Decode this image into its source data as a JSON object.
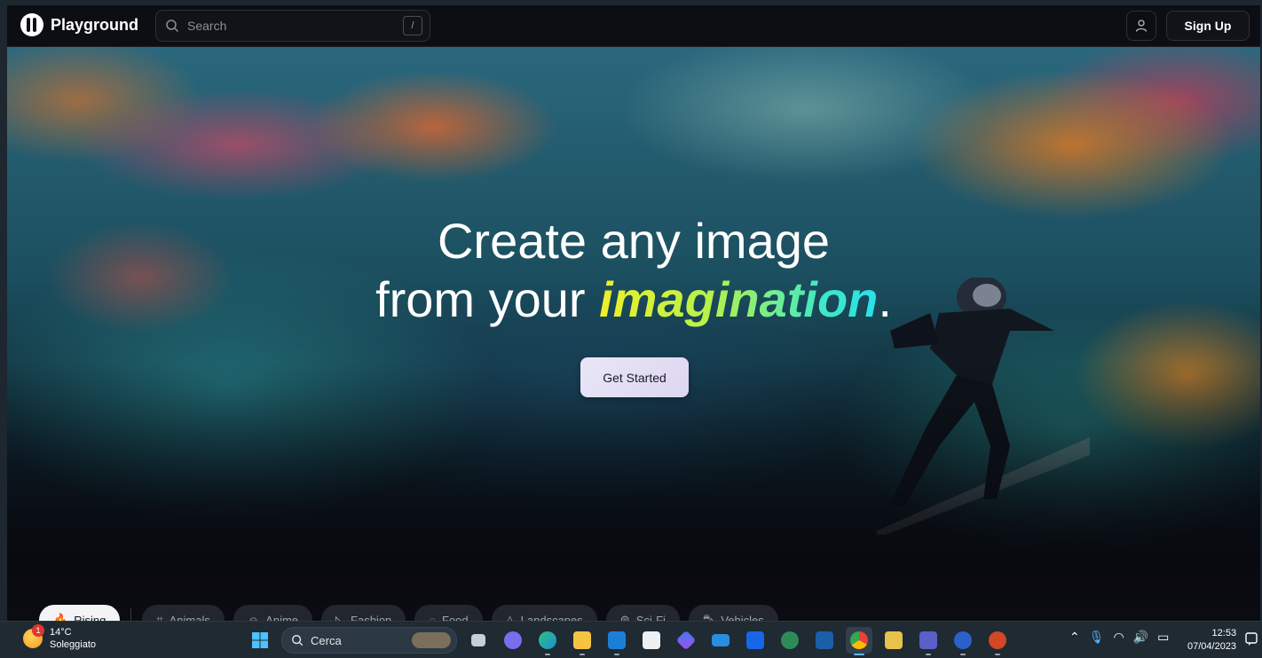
{
  "navbar": {
    "brand": "Playground",
    "search_placeholder": "Search",
    "search_shortcut": "/",
    "signup_label": "Sign Up"
  },
  "hero": {
    "headline_line1": "Create any image",
    "headline_line2_prefix": "from your ",
    "headline_highlight": "imagination",
    "headline_suffix": ".",
    "cta_label": "Get Started"
  },
  "categories": [
    {
      "label": "Rising",
      "icon": "flame-icon",
      "active": true
    },
    {
      "label": "Animals",
      "icon": "cat-icon",
      "active": false
    },
    {
      "label": "Anime",
      "icon": "smile-icon",
      "active": false
    },
    {
      "label": "Fashion",
      "icon": "hanger-icon",
      "active": false
    },
    {
      "label": "Food",
      "icon": "food-icon",
      "active": false
    },
    {
      "label": "Landscapes",
      "icon": "mountain-icon",
      "active": false
    },
    {
      "label": "Sci-Fi",
      "icon": "ufo-icon",
      "active": false
    },
    {
      "label": "Vehicles",
      "icon": "car-icon",
      "active": false
    }
  ],
  "taskbar": {
    "weather_temp": "14°C",
    "weather_desc": "Soleggiato",
    "weather_badge": "1",
    "search_label": "Cerca",
    "time": "12:53",
    "date": "07/04/2023",
    "apps": [
      "windows-start-icon",
      "task-view-icon",
      "teams-chat-icon",
      "edge-icon",
      "file-explorer-icon",
      "outlook-icon",
      "store-icon",
      "copilot-icon",
      "mail-icon",
      "dropbox-icon",
      "globe-app-icon",
      "w-app-icon",
      "chrome-icon",
      "folder-app-icon",
      "teams-icon",
      "webex-icon",
      "powerpoint-icon"
    ],
    "colors": {
      "bar": "#1f2a33",
      "accent": "#5fb8ff"
    }
  },
  "colors": {
    "nav_bg": "#0d0e13",
    "highlight_start": "#f0ef2a",
    "highlight_end": "#27e0ea",
    "cta_bg": "#e6e2f5"
  }
}
